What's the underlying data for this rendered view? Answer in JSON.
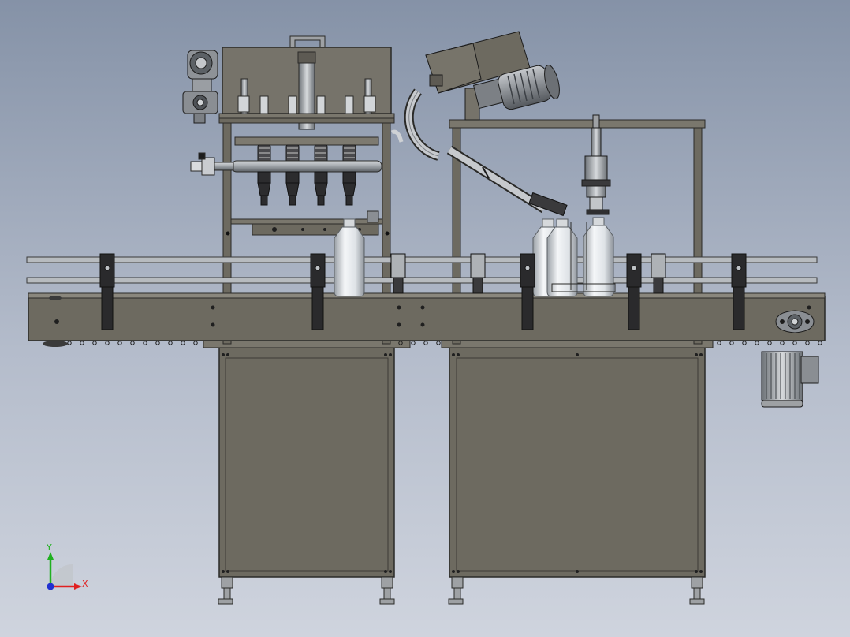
{
  "viewport": {
    "background_top": "#8592a7",
    "background_bottom": "#cfd4de"
  },
  "colors": {
    "frame": "#6d6a60",
    "frame_dark": "#57544c",
    "steel": "#b8bcc1",
    "steel_dark": "#2e2e30",
    "bottle": "#e9ecef",
    "motor": "#8c8f94"
  },
  "triad": {
    "x_label": "X",
    "y_label": "Y",
    "x_color": "#e02020",
    "y_color": "#20b020",
    "z_color": "#2030d0"
  }
}
